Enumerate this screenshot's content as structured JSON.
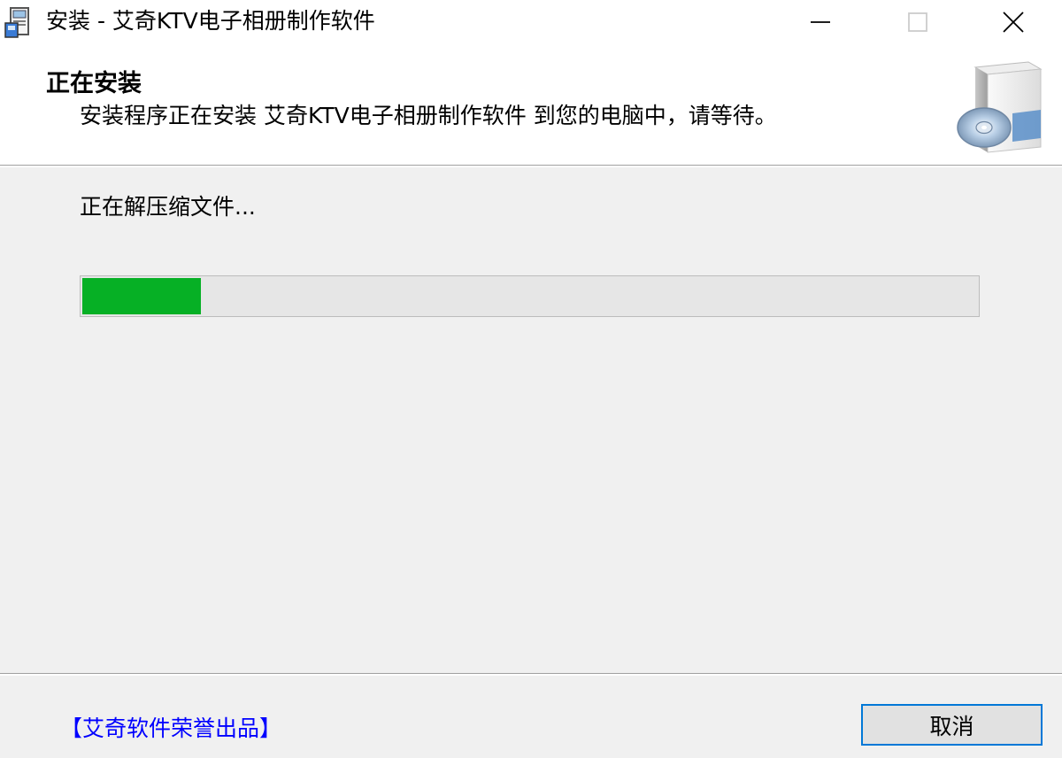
{
  "window": {
    "title": "安装 - 艾奇KTV电子相册制作软件",
    "icons": {
      "app": "installer-package-icon",
      "minimize": "minimize-icon",
      "maximize": "maximize-icon",
      "close": "close-icon"
    }
  },
  "header": {
    "title": "正在安装",
    "subtitle": "安装程序正在安装 艾奇KTV电子相册制作软件 到您的电脑中，请等待。",
    "icon": "setup-box-disc-icon"
  },
  "main": {
    "status": "正在解压缩文件...",
    "progress_percent": 13.3,
    "progress_color": "#06b025"
  },
  "footer": {
    "brand_link": "【艾奇软件荣誉出品】",
    "brand_color": "#0000ff",
    "cancel_label": "取消"
  }
}
